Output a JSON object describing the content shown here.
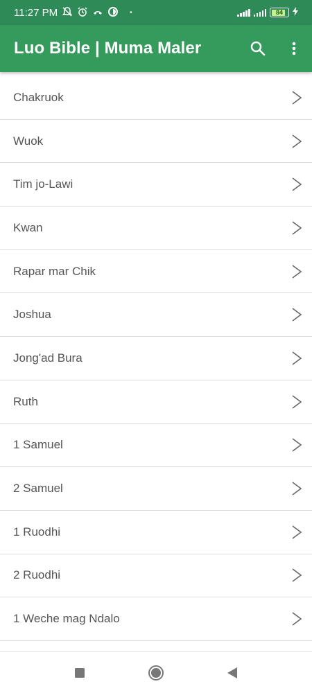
{
  "status_bar": {
    "time": "11:27 PM",
    "battery_percent": "84",
    "battery_level": 0.84,
    "icons": [
      "mute-icon",
      "alarm-icon",
      "call-icon",
      "data-saver-icon",
      "dot-icon",
      "signal-icon",
      "signal-icon",
      "battery-icon",
      "charging-icon"
    ]
  },
  "app_bar": {
    "title": "Luo Bible | Muma Maler",
    "actions": [
      "search-icon",
      "more-vert-icon"
    ]
  },
  "books": [
    {
      "name": "Chakruok"
    },
    {
      "name": "Wuok"
    },
    {
      "name": "Tim jo-Lawi"
    },
    {
      "name": "Kwan"
    },
    {
      "name": "Rapar mar Chik"
    },
    {
      "name": "Joshua"
    },
    {
      "name": "Jong'ad Bura"
    },
    {
      "name": "Ruth"
    },
    {
      "name": "1 Samuel"
    },
    {
      "name": "2 Samuel"
    },
    {
      "name": "1 Ruodhi"
    },
    {
      "name": "2 Ruodhi"
    },
    {
      "name": "1 Weche mag Ndalo"
    }
  ],
  "nav_bar": {
    "buttons": [
      "recents-icon",
      "home-icon",
      "back-icon"
    ]
  },
  "colors": {
    "status_bar": "#2e8b57",
    "app_bar": "#349b5c",
    "text": "#555555"
  }
}
